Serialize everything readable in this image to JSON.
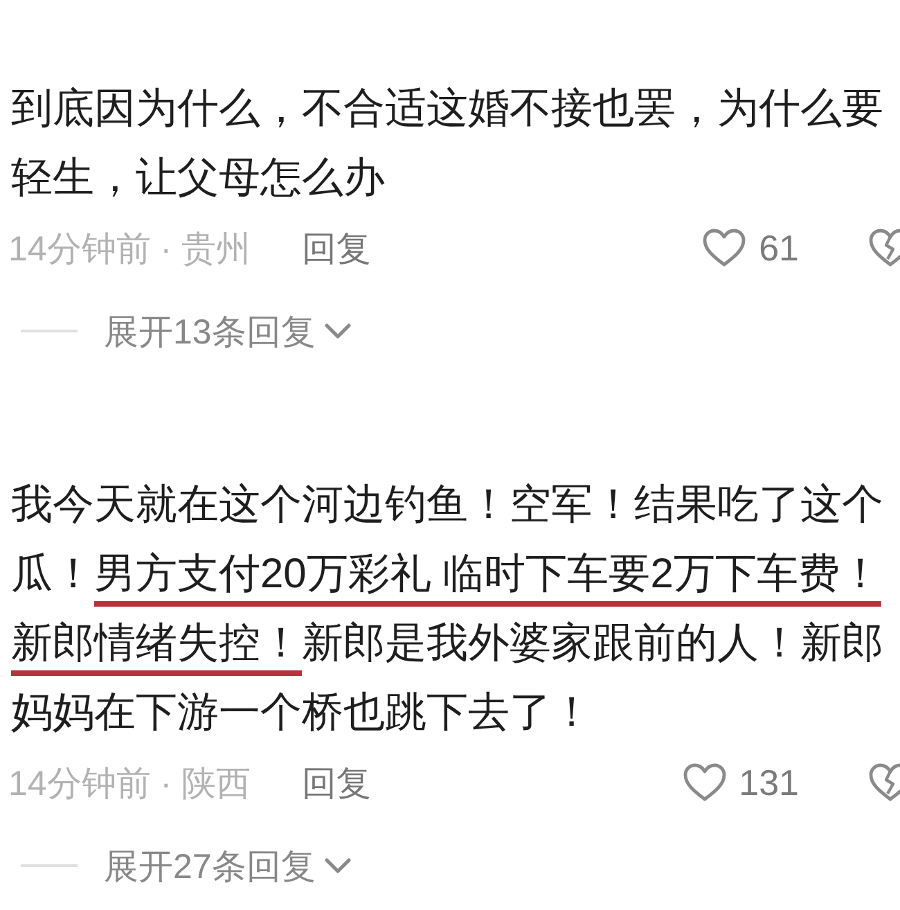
{
  "comments": [
    {
      "segments": [
        {
          "text": "到底因为什么，不合适这婚不接也罢，为什么要轻生，让父母怎么办",
          "underlined": false
        }
      ],
      "meta": "14分钟前 · 贵州",
      "reply": "回复",
      "like_count": "61",
      "expand_replies": "展开13条回复"
    },
    {
      "segments": [
        {
          "text": "我今天就在这个河边钓鱼！空军！结果吃了这个瓜！",
          "underlined": false
        },
        {
          "text": "男方支付20万彩礼 临时下车要2万下车费！新郎情绪失控！",
          "underlined": true
        },
        {
          "text": "新郎是我外婆家跟前的人！新郎妈妈在下游一个桥也跳下去了！",
          "underlined": false
        }
      ],
      "meta": "14分钟前 · 陕西",
      "reply": "回复",
      "like_count": "131",
      "expand_replies": "展开27条回复"
    }
  ]
}
